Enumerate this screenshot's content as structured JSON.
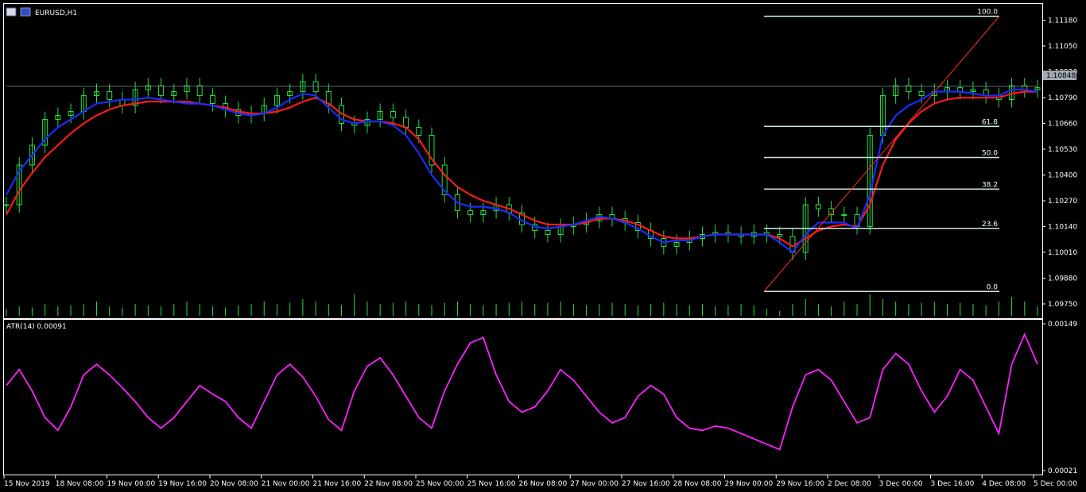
{
  "window": {
    "symbol_title": "EURUSD,H1",
    "current_price_label": "1.10848"
  },
  "colors": {
    "background": "#000000",
    "candles": "#22e040",
    "volume": "#22e040",
    "ma_fast": "#1a2cff",
    "ma_slow": "#ff1a1a",
    "fib_lines": "#c8e6e0",
    "fib_trend": "#ff2a2a",
    "atr": "#ff20ff",
    "axis": "#ffffff",
    "bid_line": "#7a8a9a"
  },
  "chart_data": [
    {
      "type": "candlestick",
      "title": "EURUSD,H1",
      "ylim": [
        1.0969,
        1.1125
      ],
      "price_axis_ticks": [
        "1.11180",
        "1.11050",
        "1.10920",
        "1.10790",
        "1.10660",
        "1.10530",
        "1.10400",
        "1.10270",
        "1.10140",
        "1.10010",
        "1.09880",
        "1.09750"
      ],
      "series": [
        {
          "name": "price_close_approx",
          "values": [
            1.1025,
            1.1045,
            1.1055,
            1.1068,
            1.107,
            1.1072,
            1.108,
            1.1082,
            1.1078,
            1.1075,
            1.1083,
            1.1085,
            1.108,
            1.1082,
            1.1085,
            1.108,
            1.1076,
            1.1073,
            1.107,
            1.1071,
            1.1075,
            1.108,
            1.1082,
            1.1087,
            1.1082,
            1.1075,
            1.1066,
            1.1065,
            1.1068,
            1.1072,
            1.1069,
            1.1064,
            1.106,
            1.1045,
            1.103,
            1.1022,
            1.102,
            1.1022,
            1.1025,
            1.1021,
            1.1015,
            1.1012,
            1.101,
            1.1014,
            1.1015,
            1.1017,
            1.102,
            1.1018,
            1.1016,
            1.1012,
            1.1008,
            1.1004,
            1.1006,
            1.1008,
            1.101,
            1.1011,
            1.101,
            1.1009,
            1.1011,
            1.101,
            1.1009,
            1.1001,
            1.1025,
            1.1023,
            1.102,
            1.102,
            1.1014,
            1.106,
            1.108,
            1.1085,
            1.1082,
            1.108,
            1.1082,
            1.1084,
            1.1082,
            1.1083,
            1.108,
            1.1078,
            1.1085,
            1.1083,
            1.1084
          ]
        },
        {
          "name": "ma_fast",
          "values": [
            1.103,
            1.1042,
            1.105,
            1.1058,
            1.1064,
            1.1068,
            1.1072,
            1.1076,
            1.1077,
            1.1078,
            1.1078,
            1.1079,
            1.1078,
            1.1077,
            1.1076,
            1.1076,
            1.1075,
            1.1073,
            1.1071,
            1.107,
            1.1071,
            1.1074,
            1.1078,
            1.1081,
            1.108,
            1.1074,
            1.1068,
            1.1066,
            1.1067,
            1.1067,
            1.1065,
            1.106,
            1.1051,
            1.104,
            1.1032,
            1.1026,
            1.1024,
            1.1024,
            1.1023,
            1.1021,
            1.1017,
            1.1014,
            1.1013,
            1.1014,
            1.1015,
            1.1017,
            1.1019,
            1.1018,
            1.1016,
            1.1013,
            1.1009,
            1.1006,
            1.1007,
            1.1007,
            1.1009,
            1.101,
            1.101,
            1.101,
            1.101,
            1.101,
            1.1006,
            1.1001,
            1.101,
            1.1016,
            1.1016,
            1.1016,
            1.1013,
            1.103,
            1.106,
            1.107,
            1.1075,
            1.1078,
            1.1082,
            1.1082,
            1.1082,
            1.1081,
            1.108,
            1.108,
            1.1083,
            1.1083,
            1.1082
          ]
        },
        {
          "name": "ma_slow",
          "values": [
            1.102,
            1.1032,
            1.1041,
            1.1049,
            1.1055,
            1.1061,
            1.1066,
            1.107,
            1.1073,
            1.1075,
            1.1076,
            1.1077,
            1.1077,
            1.1077,
            1.1077,
            1.1076,
            1.1075,
            1.1074,
            1.1072,
            1.1071,
            1.1071,
            1.1072,
            1.1074,
            1.1077,
            1.1079,
            1.1076,
            1.1071,
            1.1068,
            1.1067,
            1.1067,
            1.1066,
            1.1064,
            1.1058,
            1.1048,
            1.104,
            1.1034,
            1.103,
            1.1027,
            1.1025,
            1.1023,
            1.102,
            1.1017,
            1.1015,
            1.1015,
            1.1015,
            1.1016,
            1.1018,
            1.1018,
            1.1017,
            1.1015,
            1.1012,
            1.1009,
            1.1008,
            1.1008,
            1.1009,
            1.101,
            1.101,
            1.101,
            1.101,
            1.101,
            1.1008,
            1.1004,
            1.1008,
            1.1012,
            1.1014,
            1.1015,
            1.1014,
            1.1025,
            1.1045,
            1.1058,
            1.1066,
            1.1072,
            1.1076,
            1.1078,
            1.1079,
            1.1079,
            1.1079,
            1.1079,
            1.1081,
            1.1082,
            1.1082
          ]
        },
        {
          "name": "volume_relative",
          "values": [
            0.3,
            0.4,
            0.35,
            0.5,
            0.4,
            0.45,
            0.5,
            0.6,
            0.4,
            0.35,
            0.5,
            0.45,
            0.4,
            0.5,
            0.6,
            0.5,
            0.4,
            0.35,
            0.45,
            0.5,
            0.6,
            0.5,
            0.55,
            0.7,
            0.6,
            0.5,
            0.45,
            0.9,
            0.6,
            0.5,
            0.55,
            0.6,
            0.5,
            0.45,
            0.55,
            0.6,
            0.5,
            0.45,
            0.5,
            0.55,
            0.6,
            0.5,
            0.55,
            0.6,
            0.5,
            0.45,
            0.5,
            0.55,
            0.5,
            0.45,
            0.5,
            0.55,
            0.5,
            0.45,
            0.5,
            0.4,
            0.45,
            0.5,
            0.45,
            0.3,
            0.2,
            0.5,
            0.7,
            0.5,
            0.4,
            0.6,
            0.5,
            0.9,
            0.7,
            0.6,
            0.5,
            0.55,
            0.6,
            0.5,
            0.55,
            0.5,
            0.45,
            0.6,
            0.8,
            0.6,
            0.4
          ]
        }
      ],
      "fibonacci": {
        "levels": [
          {
            "label": "100.0",
            "value": 1.112
          },
          {
            "label": "61.8",
            "value": 1.10645
          },
          {
            "label": "50.0",
            "value": 1.10488
          },
          {
            "label": "38.2",
            "value": 1.10329
          },
          {
            "label": "23.6",
            "value": 1.10131
          },
          {
            "label": "0.0",
            "value": 1.09813
          }
        ],
        "trend_from": 1.09813,
        "trend_to": 1.112
      },
      "bid_line_value": 1.10848
    },
    {
      "type": "line",
      "title": "ATR(14) 0.00091",
      "ylim": [
        0.00021,
        0.00149
      ],
      "axis_ticks": [
        "0.00149",
        "0.00021"
      ],
      "series": [
        {
          "name": "ATR(14)",
          "values": [
            0.001,
            0.00115,
            0.00095,
            0.0007,
            0.00058,
            0.0008,
            0.0011,
            0.0012,
            0.0011,
            0.00098,
            0.00085,
            0.0007,
            0.0006,
            0.0007,
            0.00085,
            0.001,
            0.00092,
            0.00085,
            0.0007,
            0.0006,
            0.00085,
            0.0011,
            0.0012,
            0.00108,
            0.0009,
            0.00068,
            0.00058,
            0.00095,
            0.00118,
            0.00126,
            0.0011,
            0.0009,
            0.0007,
            0.0006,
            0.00095,
            0.0012,
            0.0014,
            0.00145,
            0.0011,
            0.00085,
            0.00075,
            0.0008,
            0.00095,
            0.00115,
            0.00105,
            0.0009,
            0.00075,
            0.00065,
            0.0007,
            0.0009,
            0.001,
            0.00092,
            0.0007,
            0.0006,
            0.00058,
            0.00062,
            0.0006,
            0.00055,
            0.0005,
            0.00045,
            0.0004,
            0.0008,
            0.0011,
            0.00115,
            0.00105,
            0.00085,
            0.00065,
            0.0007,
            0.00115,
            0.0013,
            0.0012,
            0.00095,
            0.00075,
            0.0009,
            0.00115,
            0.00105,
            0.0008,
            0.00055,
            0.0012,
            0.00148,
            0.0012
          ]
        }
      ]
    }
  ],
  "time_axis_labels": [
    "15 Nov 2019",
    "18 Nov 08:00",
    "19 Nov 00:00",
    "19 Nov 16:00",
    "20 Nov 08:00",
    "21 Nov 00:00",
    "21 Nov 16:00",
    "22 Nov 08:00",
    "25 Nov 00:00",
    "25 Nov 16:00",
    "26 Nov 08:00",
    "27 Nov 00:00",
    "27 Nov 16:00",
    "28 Nov 08:00",
    "29 Nov 00:00",
    "29 Nov 16:00",
    "2 Dec 08:00",
    "3 Dec 00:00",
    "3 Dec 16:00",
    "4 Dec 08:00",
    "5 Dec 00:00"
  ]
}
